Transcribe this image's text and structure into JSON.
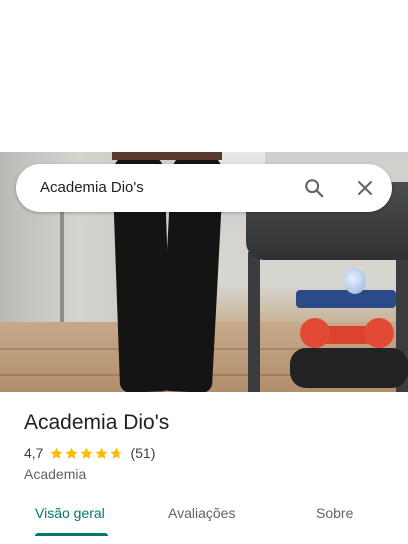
{
  "search": {
    "query": "Academia Dio's"
  },
  "place": {
    "name": "Academia Dio's",
    "rating": "4,7",
    "rating_stars": 4.7,
    "review_count": "(51)",
    "category": "Academia"
  },
  "tabs": [
    {
      "label": "Visão geral",
      "active": true
    },
    {
      "label": "Avaliações",
      "active": false
    },
    {
      "label": "Sobre",
      "active": false
    }
  ],
  "colors": {
    "accent": "#00796b",
    "star": "#fbbc04",
    "star_empty": "#dadce0"
  },
  "icons": {
    "search": "search-icon",
    "close": "close-icon",
    "star": "star-icon"
  }
}
